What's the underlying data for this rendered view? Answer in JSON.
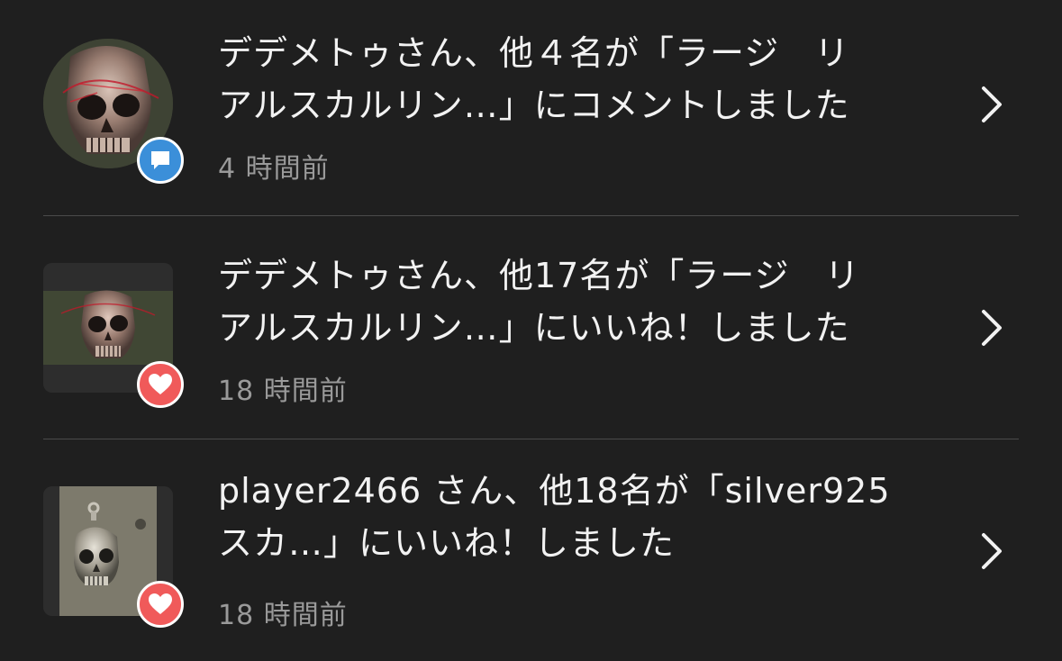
{
  "notifications": [
    {
      "line1": "デデメトゥさん、他４名が「ラージ　リ",
      "line2": "アルスカルリン…」にコメントしました",
      "time": "4 時間前",
      "badge_icon": "comment-icon",
      "badge_color": "#3b8fd9"
    },
    {
      "line1": "デデメトゥさん、他17名が「ラージ　リ",
      "line2": "アルスカルリン…」にいいね！しました",
      "time": "18 時間前",
      "badge_icon": "heart-icon",
      "badge_color": "#f05a5a"
    },
    {
      "line1": "player2466 さん、他18名が「silver925",
      "line2": "スカ…」にいいね！しました",
      "time": "18 時間前",
      "badge_icon": "heart-icon",
      "badge_color": "#f05a5a"
    }
  ],
  "chevron_icon": "chevron-right-icon"
}
